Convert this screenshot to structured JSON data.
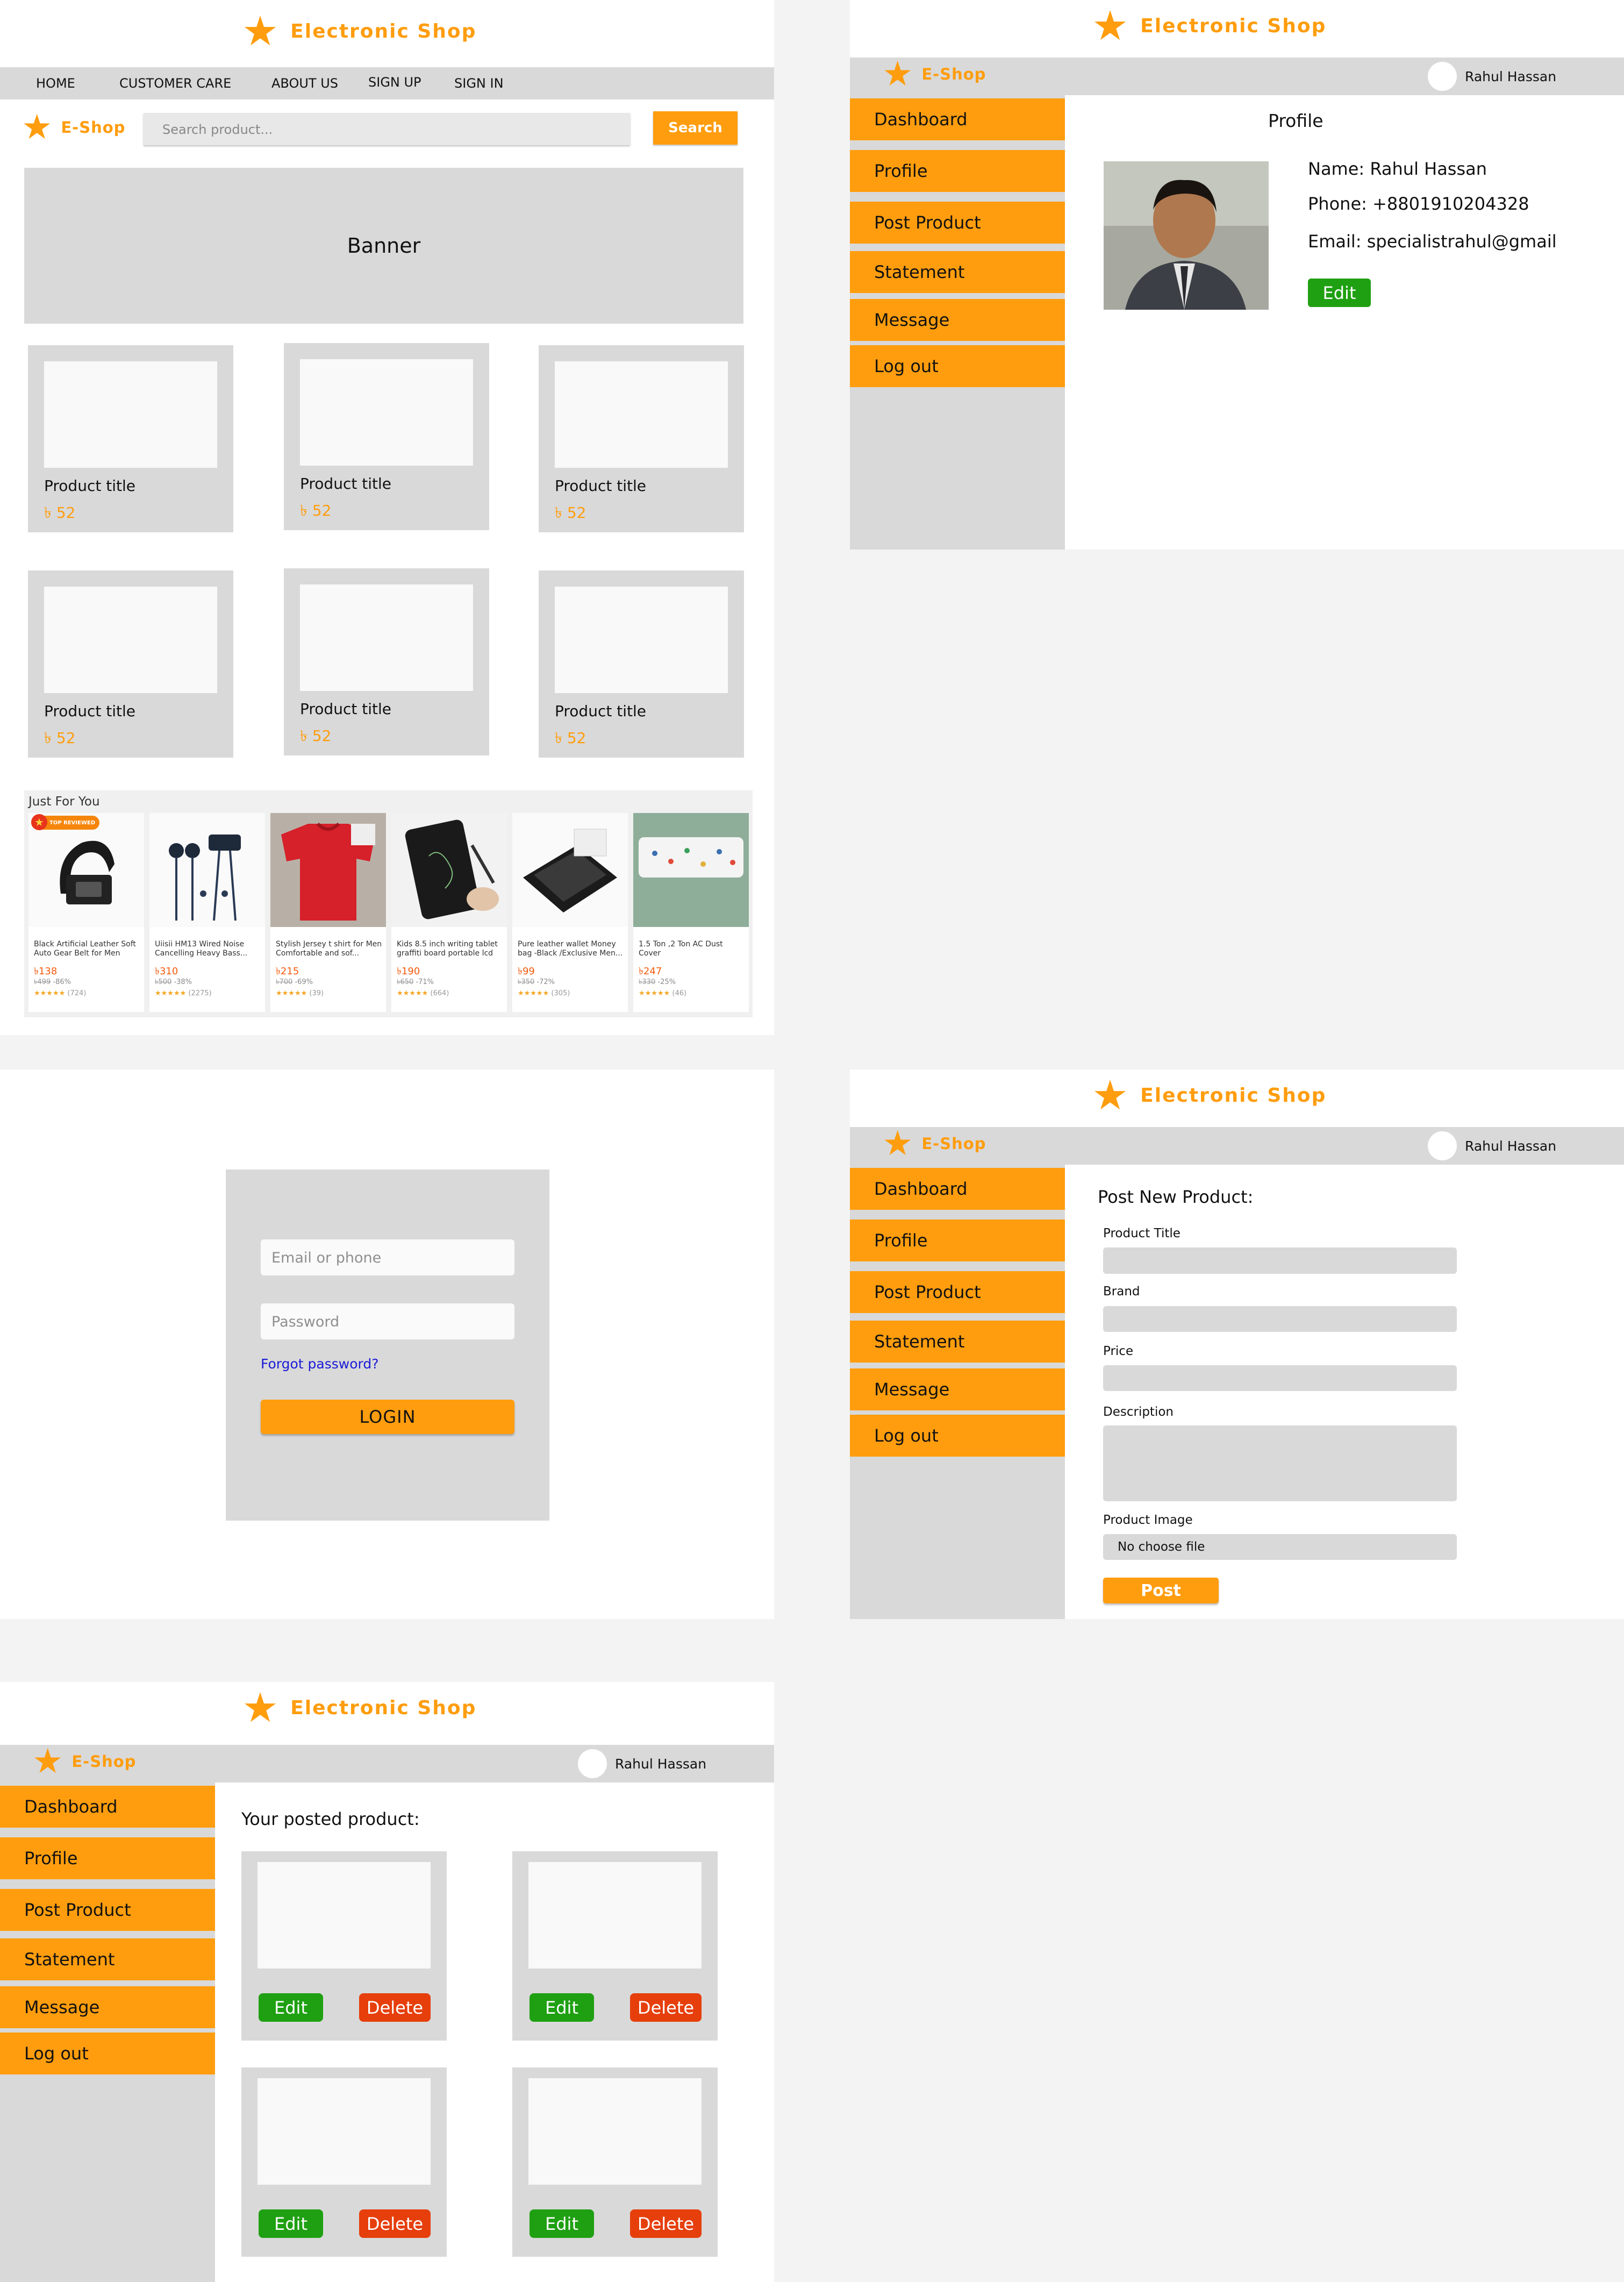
{
  "brand": {
    "site_title": "Electronic Shop",
    "short_name": "E-Shop"
  },
  "colors": {
    "accent": "#ff9d0e",
    "panel_gray": "#d9d9d9",
    "edit_green": "#1fa012",
    "delete_red": "#e63f0c",
    "page_bg": "#f3f3f3"
  },
  "home": {
    "nav": [
      "HOME",
      "CUSTOMER CARE",
      "ABOUT US",
      "SIGN UP",
      "SIGN IN"
    ],
    "search_placeholder": "Search product...",
    "search_button": "Search",
    "banner": "Banner",
    "products": [
      {
        "title": "Product title",
        "price": "৳ 52"
      },
      {
        "title": "Product title",
        "price": "৳ 52"
      },
      {
        "title": "Product title",
        "price": "৳ 52"
      },
      {
        "title": "Product title",
        "price": "৳ 52"
      },
      {
        "title": "Product title",
        "price": "৳ 52"
      },
      {
        "title": "Product title",
        "price": "৳ 52"
      }
    ],
    "just_for_you": {
      "heading": "Just For You",
      "badge": "TOP REVIEWED",
      "items": [
        {
          "name": "Black Artificial Leather Soft Auto Gear Belt for Men",
          "price": "৳138",
          "old": "৳499",
          "discount": "-86%",
          "reviews": "(724)"
        },
        {
          "name": "Uiisii HM13 Wired Noise Cancelling Heavy Bass...",
          "price": "৳310",
          "old": "৳500",
          "discount": "-38%",
          "reviews": "(2275)"
        },
        {
          "name": "Stylish Jersey t shirt for Men Comfortable and sof...",
          "price": "৳215",
          "old": "৳700",
          "discount": "-69%",
          "reviews": "(39)"
        },
        {
          "name": "Kids 8.5 inch writing tablet graffiti board portable lcd",
          "price": "৳190",
          "old": "৳650",
          "discount": "-71%",
          "reviews": "(664)"
        },
        {
          "name": "Pure leather wallet Money bag -Black /Exclusive Men...",
          "price": "৳99",
          "old": "৳350",
          "discount": "-72%",
          "reviews": "(305)"
        },
        {
          "name": "1.5 Ton ,2 Ton AC Dust Cover",
          "price": "৳247",
          "old": "৳330",
          "discount": "-25%",
          "reviews": "(46)"
        }
      ]
    }
  },
  "dashboard": {
    "user": "Rahul Hassan",
    "menu": [
      "Dashboard",
      "Profile",
      "Post Product",
      "Statement",
      "Message",
      "Log out"
    ]
  },
  "profile": {
    "heading": "Profile",
    "name": "Name: Rahul Hassan",
    "phone": "Phone: +8801910204328",
    "email": "Email: specialistrahul@gmail",
    "edit": "Edit"
  },
  "login": {
    "email_placeholder": "Email or phone",
    "password_placeholder": "Password",
    "forgot": "Forgot password?",
    "button": "LOGIN"
  },
  "post_product": {
    "heading": "Post New Product:",
    "labels": [
      "Product Title",
      "Brand",
      "Price",
      "Description",
      "Product Image"
    ],
    "file_text": "No choose file",
    "button": "Post"
  },
  "posted": {
    "heading": "Your posted product:",
    "edit": "Edit",
    "delete": "Delete"
  }
}
